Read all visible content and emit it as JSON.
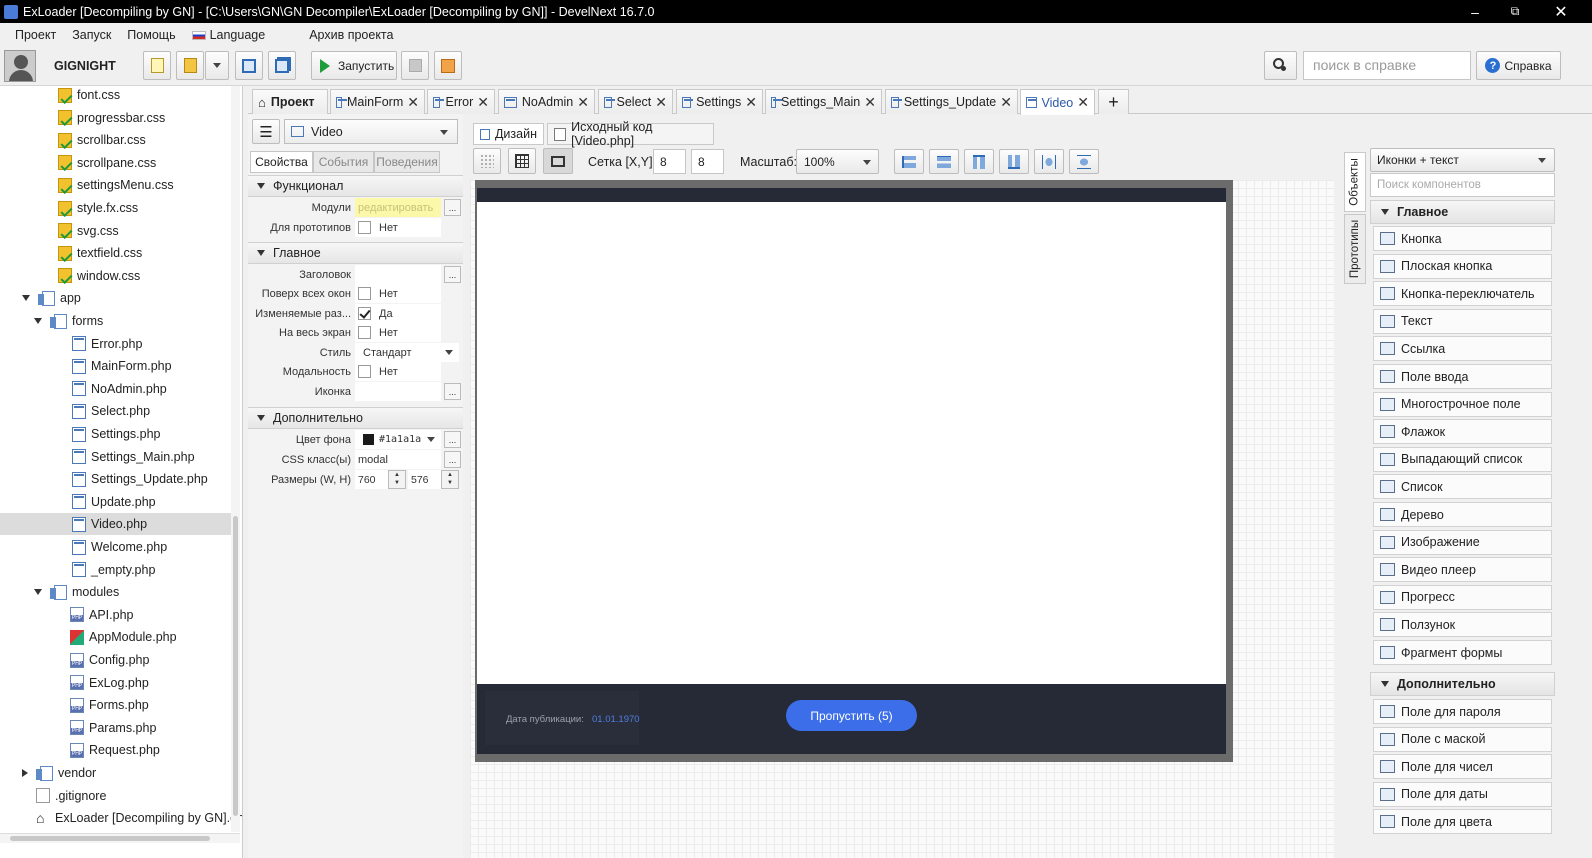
{
  "window": {
    "title": "ExLoader [Decompiling by GN] - [C:\\Users\\GN\\GN Decompiler\\ExLoader [Decompiling by GN]] - DevelNext 16.7.0"
  },
  "menu": [
    "Проект",
    "Запуск",
    "Помощь",
    "Language",
    "Архив проекта"
  ],
  "toolbar": {
    "username": "GIGNIGHT",
    "run_label": "Запустить",
    "search_placeholder": "поиск в справке",
    "help_label": "Справка"
  },
  "tree": [
    {
      "label": "font.css",
      "type": "css",
      "indent": 2
    },
    {
      "label": "progressbar.css",
      "type": "css",
      "indent": 2
    },
    {
      "label": "scrollbar.css",
      "type": "css",
      "indent": 2
    },
    {
      "label": "scrollpane.css",
      "type": "css",
      "indent": 2
    },
    {
      "label": "settingsMenu.css",
      "type": "css",
      "indent": 2
    },
    {
      "label": "style.fx.css",
      "type": "css",
      "indent": 2
    },
    {
      "label": "svg.css",
      "type": "css",
      "indent": 2
    },
    {
      "label": "textfield.css",
      "type": "css",
      "indent": 2
    },
    {
      "label": "window.css",
      "type": "css",
      "indent": 2
    },
    {
      "label": "app",
      "type": "folder",
      "indent": 1,
      "expanded": true
    },
    {
      "label": "forms",
      "type": "folder",
      "indent": 2,
      "expanded": true
    },
    {
      "label": "Error.php",
      "type": "form",
      "indent": 3
    },
    {
      "label": "MainForm.php",
      "type": "form",
      "indent": 3
    },
    {
      "label": "NoAdmin.php",
      "type": "form",
      "indent": 3
    },
    {
      "label": "Select.php",
      "type": "form",
      "indent": 3
    },
    {
      "label": "Settings.php",
      "type": "form",
      "indent": 3
    },
    {
      "label": "Settings_Main.php",
      "type": "form",
      "indent": 3
    },
    {
      "label": "Settings_Update.php",
      "type": "form",
      "indent": 3
    },
    {
      "label": "Update.php",
      "type": "form",
      "indent": 3
    },
    {
      "label": "Video.php",
      "type": "form",
      "indent": 3,
      "selected": true
    },
    {
      "label": "Welcome.php",
      "type": "form",
      "indent": 3
    },
    {
      "label": "_empty.php",
      "type": "form",
      "indent": 3
    },
    {
      "label": "modules",
      "type": "folder",
      "indent": 2,
      "expanded": true
    },
    {
      "label": "API.php",
      "type": "php",
      "indent": 3
    },
    {
      "label": "AppModule.php",
      "type": "appmod",
      "indent": 3
    },
    {
      "label": "Config.php",
      "type": "php",
      "indent": 3
    },
    {
      "label": "ExLog.php",
      "type": "php",
      "indent": 3
    },
    {
      "label": "Forms.php",
      "type": "php",
      "indent": 3
    },
    {
      "label": "Params.php",
      "type": "php",
      "indent": 3
    },
    {
      "label": "Request.php",
      "type": "php",
      "indent": 3
    },
    {
      "label": "vendor",
      "type": "folder",
      "indent": 1,
      "expanded": false
    },
    {
      "label": ".gitignore",
      "type": "doc",
      "indent": 1
    },
    {
      "label": "ExLoader [Decompiling by GN].dn",
      "type": "home",
      "indent": 0
    }
  ],
  "tabs": [
    {
      "label": "Проект",
      "closable": false
    },
    {
      "label": "MainForm",
      "closable": true
    },
    {
      "label": "Error",
      "closable": true
    },
    {
      "label": "NoAdmin",
      "closable": true
    },
    {
      "label": "Select",
      "closable": true
    },
    {
      "label": "Settings",
      "closable": true
    },
    {
      "label": "Settings_Main",
      "closable": true
    },
    {
      "label": "Settings_Update",
      "closable": true
    },
    {
      "label": "Video",
      "closable": true,
      "active": true
    }
  ],
  "props": {
    "object_select": "Video",
    "tabs": [
      "Свойства",
      "События",
      "Поведения"
    ],
    "sections": {
      "func": "Функционал",
      "main": "Главное",
      "extra": "Дополнительно"
    },
    "rows": {
      "modules": {
        "label": "Модули",
        "value": "редактировать"
      },
      "proto": {
        "label": "Для прототипов",
        "value": "Нет"
      },
      "title": {
        "label": "Заголовок",
        "value": ""
      },
      "ontop": {
        "label": "Поверх всех окон",
        "value": "Нет"
      },
      "resizable": {
        "label": "Изменяемые раз...",
        "value": "Да"
      },
      "fullscreen": {
        "label": "На весь экран",
        "value": "Нет"
      },
      "style": {
        "label": "Стиль",
        "value": "Стандарт"
      },
      "modal": {
        "label": "Модальность",
        "value": "Нет"
      },
      "icon": {
        "label": "Иконка",
        "value": ""
      },
      "bgcolor": {
        "label": "Цвет фона",
        "value": "#1a1a1a"
      },
      "cssclass": {
        "label": "CSS класс(ы)",
        "value": "modal"
      },
      "size": {
        "label": "Размеры (W, H)",
        "w": "760",
        "h": "576"
      }
    }
  },
  "editor": {
    "tab_design": "Дизайн",
    "tab_source": "Исходный код [Video.php]",
    "grid_label": "Сетка [X,Y]:",
    "grid_x": "8",
    "grid_y": "8",
    "scale_label": "Масштаб:",
    "scale_value": "100%"
  },
  "form_preview": {
    "pub_label": "Дата публикации:",
    "pub_date": "01.01.1970",
    "skip_button": "Пропустить (5)"
  },
  "palette": {
    "side_tabs": [
      "Объекты",
      "Прототипы"
    ],
    "mode": "Иконки + текст",
    "search_placeholder": "Поиск компонентов",
    "group_main": "Главное",
    "main_items": [
      "Кнопка",
      "Плоская кнопка",
      "Кнопка-переключатель",
      "Текст",
      "Ссылка",
      "Поле ввода",
      "Многострочное поле",
      "Флажок",
      "Выпадающий список",
      "Список",
      "Дерево",
      "Изображение",
      "Видео плеер",
      "Прогресс",
      "Ползунок",
      "Фрагмент формы"
    ],
    "group_extra": "Дополнительно",
    "extra_items": [
      "Поле для пароля",
      "Поле с маской",
      "Поле для чисел",
      "Поле для даты",
      "Поле для цвета"
    ]
  },
  "colors": {
    "form_dark": "#262a36",
    "accent_button": "#3b6ee8",
    "link_blue": "#4f7de0"
  }
}
